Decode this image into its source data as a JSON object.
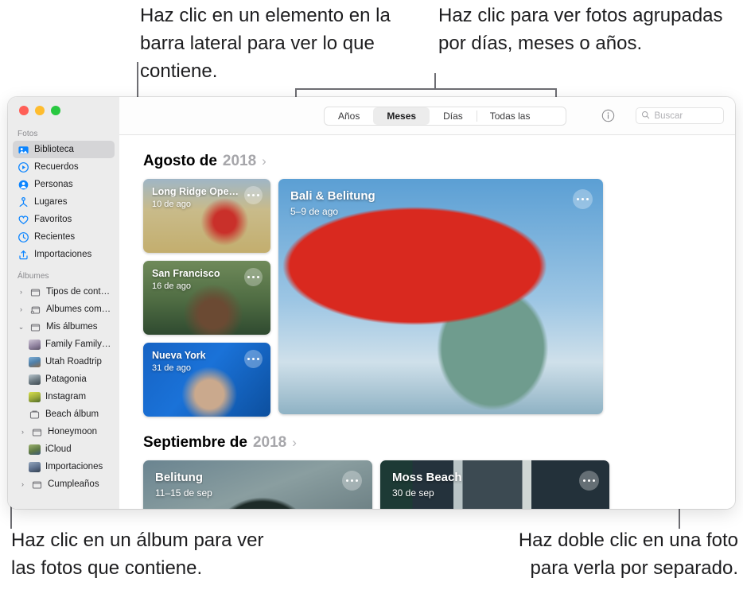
{
  "callouts": {
    "top_left": "Haz clic en un elemento en la barra lateral para ver lo que contiene.",
    "top_right": "Haz clic para ver fotos agrupadas por días, meses o años.",
    "bottom_left": "Haz clic en un álbum para ver las fotos que contiene.",
    "bottom_right": "Haz doble clic en una foto para verla por separado."
  },
  "window": {
    "traffic_lights": [
      "close",
      "minimize",
      "zoom"
    ]
  },
  "sidebar": {
    "groups": [
      {
        "title": "Fotos",
        "items": [
          {
            "label": "Biblioteca",
            "icon": "photos-library-icon",
            "selected": true
          },
          {
            "label": "Recuerdos",
            "icon": "memories-icon",
            "selected": false
          },
          {
            "label": "Personas",
            "icon": "people-icon",
            "selected": false
          },
          {
            "label": "Lugares",
            "icon": "places-pin-icon",
            "selected": false
          },
          {
            "label": "Favoritos",
            "icon": "heart-icon",
            "selected": false
          },
          {
            "label": "Recientes",
            "icon": "clock-icon",
            "selected": false
          },
          {
            "label": "Importaciones",
            "icon": "import-arrow-icon",
            "selected": false
          }
        ]
      },
      {
        "title": "Álbumes",
        "items": [
          {
            "label": "Tipos de contenido",
            "icon": "folder-icon",
            "disclosure": "collapsed"
          },
          {
            "label": "Álbumes compartidos",
            "icon": "shared-album-icon",
            "disclosure": "collapsed"
          },
          {
            "label": "Mis álbumes",
            "icon": "folder-icon",
            "disclosure": "expanded"
          },
          {
            "label": "Family Family…",
            "icon": "album-thumb",
            "thumb": "#b9b0c4",
            "indent": true
          },
          {
            "label": "Utah Roadtrip",
            "icon": "album-thumb",
            "thumb": "#6d8fae",
            "indent": true
          },
          {
            "label": "Patagonia",
            "icon": "album-thumb",
            "thumb": "#6f7b83",
            "indent": true
          },
          {
            "label": "Instagram",
            "icon": "album-thumb",
            "thumb": "#9aa83a",
            "indent": true
          },
          {
            "label": "Beach álbum",
            "icon": "album-outline-icon",
            "indent": true
          },
          {
            "label": "Honeymoon",
            "icon": "folder-icon",
            "disclosure": "collapsed",
            "indent": true
          },
          {
            "label": "iCloud",
            "icon": "album-thumb",
            "thumb": "#6d8356",
            "indent": true
          },
          {
            "label": "Importaciones",
            "icon": "album-thumb",
            "thumb": "#6a7c93",
            "indent": true
          },
          {
            "label": "Cumpleaños",
            "icon": "folder-icon",
            "disclosure": "collapsed",
            "indent": true
          }
        ]
      }
    ]
  },
  "toolbar": {
    "tabs": [
      {
        "label": "Años",
        "active": false
      },
      {
        "label": "Meses",
        "active": true
      },
      {
        "label": "Días",
        "active": false
      },
      {
        "label": "Todas las fotos",
        "active": false
      }
    ],
    "info_icon": "info-circle-icon",
    "search": {
      "placeholder": "Buscar",
      "value": "",
      "icon": "search-icon"
    }
  },
  "content": {
    "sections": [
      {
        "month": "Agosto de",
        "year": "2018",
        "chevron": "›",
        "cards": [
          {
            "title": "Long Ridge Ope…",
            "subtitle": "10 de ago",
            "size": "small"
          },
          {
            "title": "San Francisco",
            "subtitle": "16 de ago",
            "size": "small"
          },
          {
            "title": "Nueva York",
            "subtitle": "31 de ago",
            "size": "small"
          },
          {
            "title": "Bali & Belitung",
            "subtitle": "5–9 de ago",
            "size": "big"
          }
        ]
      },
      {
        "month": "Septiembre de",
        "year": "2018",
        "chevron": "›",
        "cards": [
          {
            "title": "Belitung",
            "subtitle": "11–15 de sep",
            "size": "wide"
          },
          {
            "title": "Moss Beach",
            "subtitle": "30 de sep",
            "size": "wide"
          }
        ]
      }
    ]
  },
  "colors": {
    "accent": "#0a84ff",
    "sidebar_bg": "#ececec",
    "selected_row": "#d5d5d7",
    "leader_line": "#6e6e73",
    "year_text": "#a6a6aa"
  }
}
